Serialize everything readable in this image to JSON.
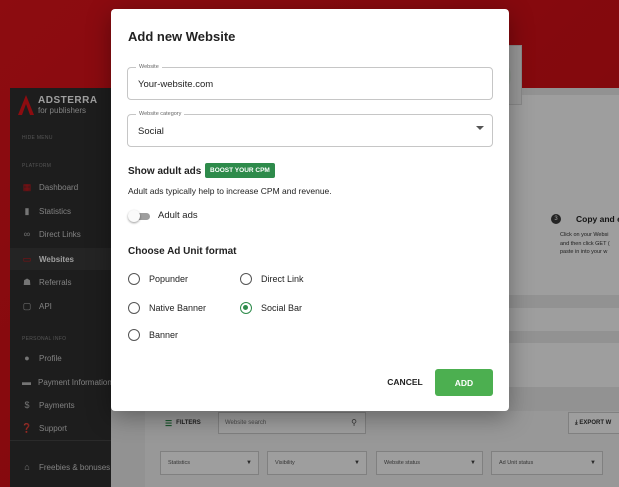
{
  "brand": {
    "name": "ADSTERRA",
    "tagline": "for publishers"
  },
  "sidebar": {
    "hide_menu": "HIDE MENU",
    "platform_label": "PLATFORM",
    "personal_label": "PERSONAL INFO",
    "items": [
      {
        "label": "Dashboard",
        "icon": "grid-icon"
      },
      {
        "label": "Statistics",
        "icon": "bar-chart-icon"
      },
      {
        "label": "Direct Links",
        "icon": "link-icon"
      },
      {
        "label": "Websites",
        "icon": "monitor-icon"
      },
      {
        "label": "Referrals",
        "icon": "users-icon"
      },
      {
        "label": "API",
        "icon": "terminal-icon"
      },
      {
        "label": "Profile",
        "icon": "person-icon"
      },
      {
        "label": "Payment Information",
        "icon": "card-icon"
      },
      {
        "label": "Payments",
        "icon": "dollar-icon"
      },
      {
        "label": "Support",
        "icon": "help-icon"
      },
      {
        "label": "Freebies & bonuses",
        "icon": "gift-icon"
      }
    ]
  },
  "step": {
    "number": "3",
    "title": "Copy and e",
    "lines": [
      "Click on your Websi",
      "and then click GET (",
      "paste in into your w"
    ]
  },
  "toolbar": {
    "filters_label": "FILTERS",
    "search_placeholder": "Website search",
    "export_label": "EXPORT W",
    "dropdowns": [
      "Statistics",
      "Visibility",
      "Website status",
      "Ad Unit status"
    ]
  },
  "modal": {
    "title": "Add new Website",
    "website_label": "Website",
    "website_value": "Your-website.com",
    "category_label": "Website category",
    "category_value": "Social",
    "adult_heading": "Show adult ads",
    "boost_badge": "BOOST YOUR CPM",
    "adult_desc": "Adult ads typically help to increase CPM and revenue.",
    "toggle_label": "Adult ads",
    "format_heading": "Choose Ad Unit format",
    "formats": [
      "Popunder",
      "Direct Link",
      "Native Banner",
      "Social Bar",
      "Banner"
    ],
    "selected_format": "Social Bar",
    "cancel_label": "CANCEL",
    "add_label": "ADD"
  },
  "colors": {
    "brand_red": "#e4141b",
    "accent_green": "#4caf50",
    "badge_green": "#2e8b4b",
    "sidebar_bg": "#2f2f2f"
  }
}
